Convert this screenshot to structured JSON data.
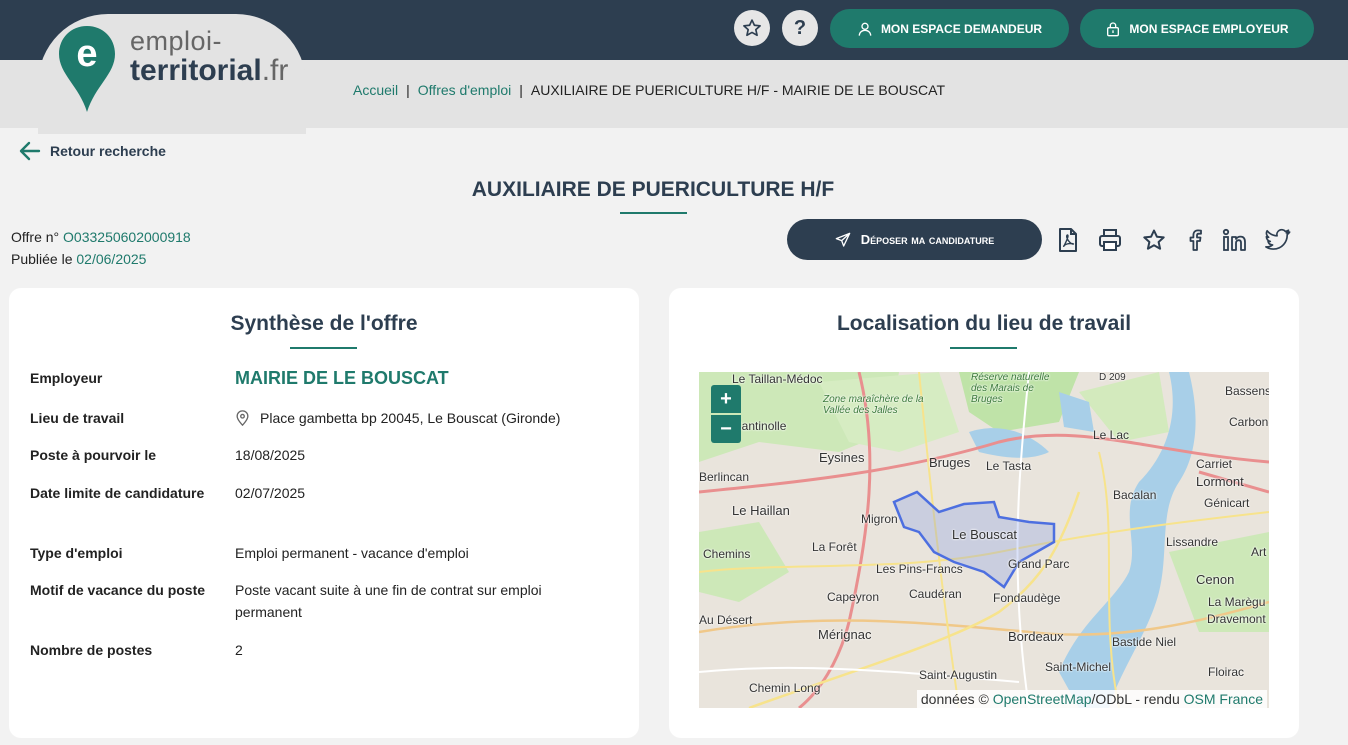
{
  "header": {
    "logo_line1": "emploi-",
    "logo_line2": "territorial",
    "logo_tld": ".fr",
    "favorites_icon": "star-icon",
    "help_icon": "question-icon",
    "btn_demandeur": "MON ESPACE DEMANDEUR",
    "btn_employeur": "MON ESPACE EMPLOYEUR"
  },
  "breadcrumb": {
    "home": "Accueil",
    "offers": "Offres d'emploi",
    "current": "AUXILIAIRE DE PUERICULTURE H/F - MAIRIE DE LE BOUSCAT",
    "sep": "|"
  },
  "back_label": "Retour recherche",
  "title": "AUXILIAIRE DE PUERICULTURE H/F",
  "offer": {
    "number_label": "Offre n°",
    "number": "O033250602000918",
    "published_label": "Publiée le",
    "published": "02/06/2025"
  },
  "actions": {
    "apply_label": "Déposer ma candidature",
    "icons": [
      "pdf-icon",
      "print-icon",
      "star-icon",
      "facebook-icon",
      "linkedin-icon",
      "twitter-icon"
    ]
  },
  "summary": {
    "title": "Synthèse de l'offre",
    "rows": [
      {
        "label": "Employeur",
        "value": "MAIRIE DE LE BOUSCAT"
      },
      {
        "label": "Lieu de travail",
        "value": "Place gambetta bp 20045, Le Bouscat (Gironde)"
      },
      {
        "label": "Poste à pourvoir le",
        "value": "18/08/2025"
      },
      {
        "label": "Date limite de candidature",
        "value": "02/07/2025"
      },
      {
        "label": "Type d'emploi",
        "value": "Emploi permanent - vacance d'emploi"
      },
      {
        "label": "Motif de vacance du poste",
        "value": "Poste vacant suite à une fin de contrat sur emploi permanent"
      },
      {
        "label": "Nombre de postes",
        "value": "2"
      }
    ]
  },
  "location": {
    "title": "Localisation du lieu de travail",
    "zoom_in": "+",
    "zoom_out": "−",
    "attribution_prefix": "données ©",
    "attribution_osm": "OpenStreetMap",
    "attribution_mid": "/ODbL - rendu",
    "attribution_osmfr": "OSM France",
    "places": [
      "Le Taillan-Médoc",
      "Cantinolle",
      "Eysines",
      "Bruges",
      "Le Tasta",
      "Le Lac",
      "Bassens",
      "Carbon-B",
      "Carriet",
      "Lormont",
      "Génicart",
      "Bacalan",
      "Berlincan",
      "Le Haillan",
      "Migron",
      "Le Bouscat",
      "Lissandre",
      "La Forêt",
      "Les Pins-Francs",
      "Grand Parc",
      "Chemins",
      "Cenon",
      "Capeyron",
      "Caudéran",
      "Fondaudège",
      "La Marègu",
      "Dravemont",
      "Au Désert",
      "Mérignac",
      "Bordeaux",
      "Bastide Niel",
      "Saint-Augustin",
      "Saint-Michel",
      "Floirac",
      "Chemin Long",
      "Art",
      "D 209"
    ],
    "zone_label": "Zone maraîchère de la Vallée des Jalles",
    "reserve_label": "Réserve naturelle des Marais de Bruges"
  }
}
